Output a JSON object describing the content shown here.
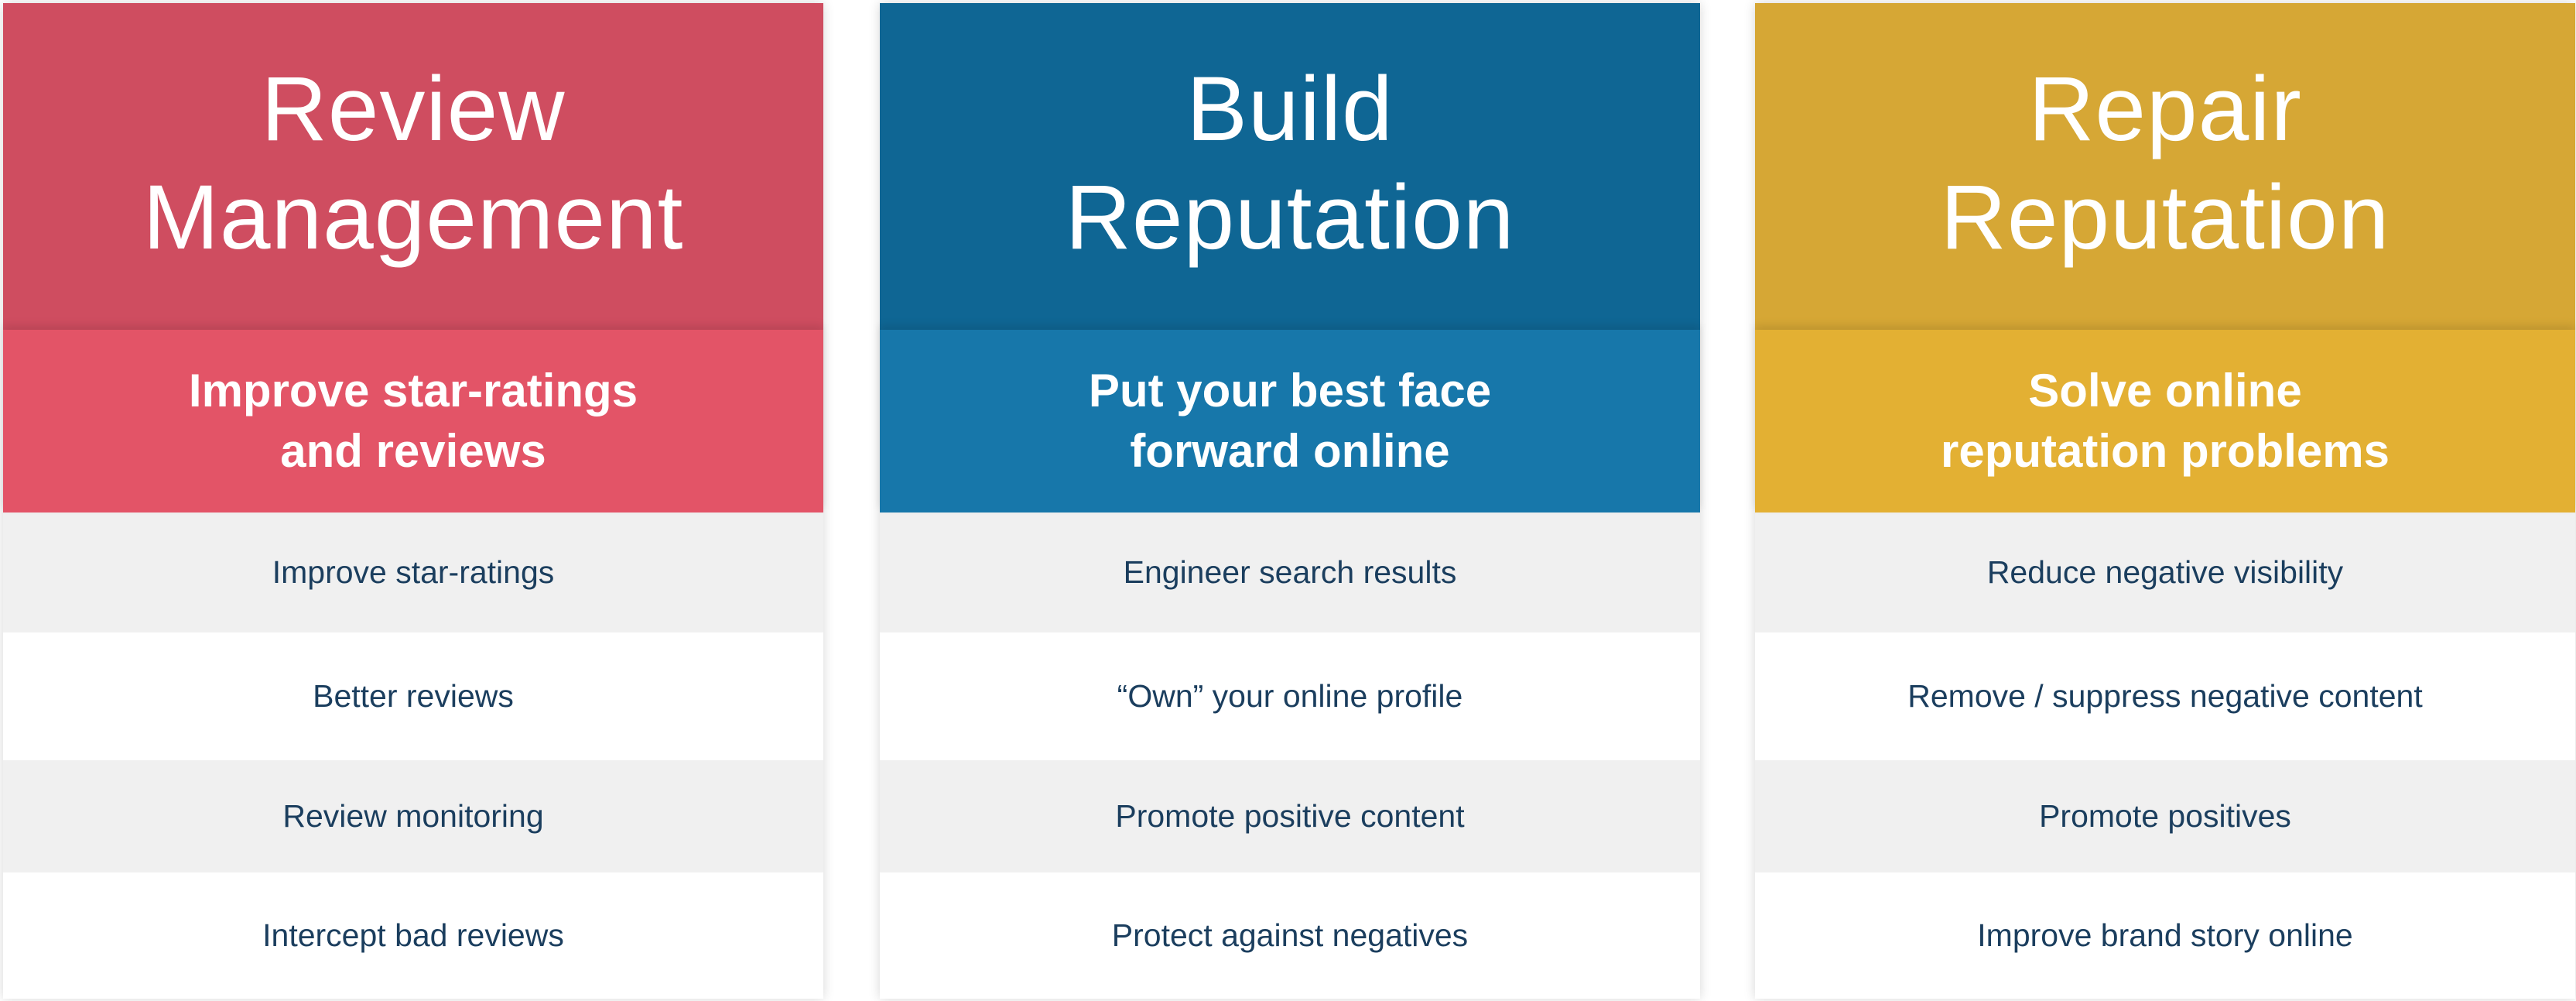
{
  "cards": [
    {
      "title_lines": [
        "Review",
        "Management"
      ],
      "subtitle_lines": [
        "Improve star-ratings",
        "and reviews"
      ],
      "items": [
        "Improve star-ratings",
        "Better reviews",
        "Review monitoring",
        "Intercept bad reviews"
      ],
      "head_color": "#cf4d60",
      "sub_color": "#e35467"
    },
    {
      "title_lines": [
        "Build",
        "Reputation"
      ],
      "subtitle_lines": [
        "Put your best face",
        "forward online"
      ],
      "items": [
        "Engineer search results",
        "“Own” your online profile",
        "Promote positive content",
        "Protect against negatives"
      ],
      "head_color": "#0f6694",
      "sub_color": "#1777aa"
    },
    {
      "title_lines": [
        "Repair",
        "Reputation"
      ],
      "subtitle_lines": [
        "Solve online",
        "reputation problems"
      ],
      "items": [
        "Reduce negative visibility",
        "Remove / suppress negative content",
        "Promote positives",
        "Improve brand story online"
      ],
      "head_color": "#d6a735",
      "sub_color": "#e3b033"
    }
  ],
  "text_colors": {
    "header_text": "#ffffff",
    "list_text": "#1b3e5e"
  }
}
